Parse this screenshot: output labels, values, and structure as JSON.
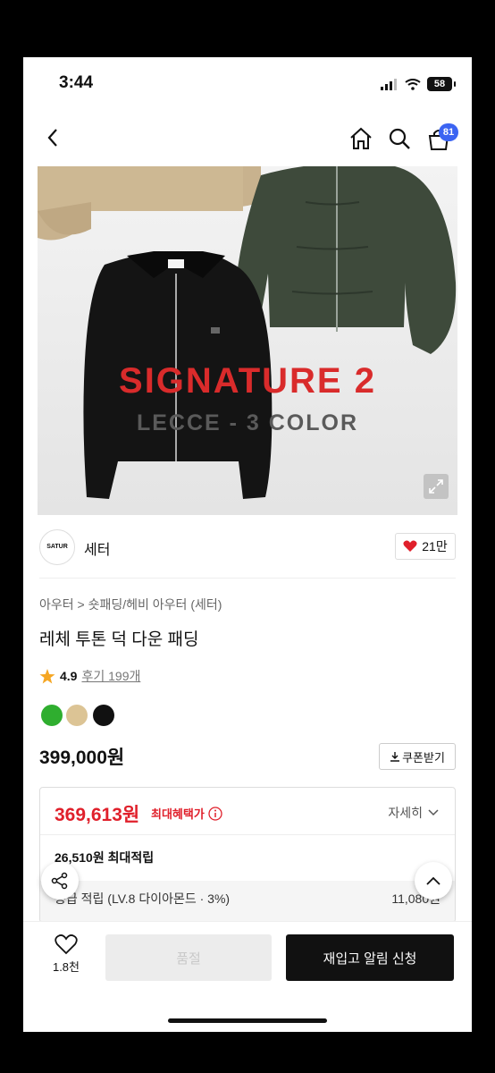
{
  "status_bar": {
    "time": "3:44",
    "battery": "58"
  },
  "header": {
    "cart_count": "81"
  },
  "hero": {
    "headline": "SIGNATURE 2",
    "subline": "LECCE - 3 COLOR",
    "tag_text": "SATUR"
  },
  "brand": {
    "name": "세터",
    "logo_text": "SATUR",
    "likes": "21만"
  },
  "breadcrumb": {
    "category": "아우터",
    "sub": "숏패딩/헤비 아우터 (세터)"
  },
  "product": {
    "title": "레체 투톤 덕 다운 패딩",
    "rating": "4.9",
    "review_label": "후기 199개",
    "colors": [
      "#2fae2f",
      "#dcc495",
      "#111111"
    ],
    "price": "399,000원",
    "coupon_label": "쿠폰받기"
  },
  "benefit": {
    "max_price": "369,613원",
    "max_label": "최대혜택가",
    "detail_label": "자세히",
    "points": "26,510원 최대적립",
    "row1_label": "등급 적립 (LV.8 다이아몬드 · 3%)",
    "row1_value": "11,080원"
  },
  "bottom_bar": {
    "wish_count": "1.8천",
    "soldout_label": "품절",
    "restock_label": "재입고 알림 신청"
  }
}
